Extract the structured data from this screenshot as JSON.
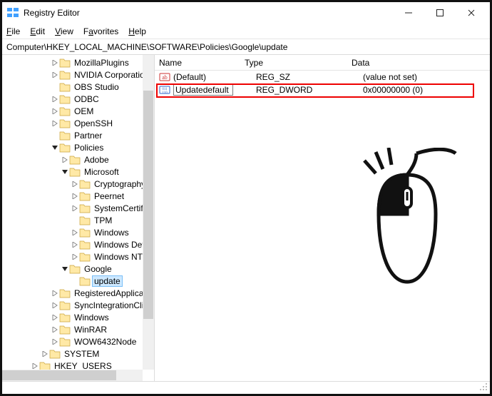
{
  "title": "Registry Editor",
  "win": {
    "min": "—",
    "max": "▢",
    "close": "✕"
  },
  "menus": {
    "file": "File",
    "edit": "Edit",
    "view": "View",
    "favorites": "Favorites",
    "help": "Help"
  },
  "address": "Computer\\HKEY_LOCAL_MACHINE\\SOFTWARE\\Policies\\Google\\update",
  "tree": {
    "items": [
      {
        "indent": 4,
        "chev": ">",
        "label": "MozillaPlugins"
      },
      {
        "indent": 4,
        "chev": ">",
        "label": "NVIDIA Corporation"
      },
      {
        "indent": 4,
        "chev": "",
        "label": "OBS Studio"
      },
      {
        "indent": 4,
        "chev": ">",
        "label": "ODBC"
      },
      {
        "indent": 4,
        "chev": ">",
        "label": "OEM"
      },
      {
        "indent": 4,
        "chev": ">",
        "label": "OpenSSH"
      },
      {
        "indent": 4,
        "chev": "",
        "label": "Partner"
      },
      {
        "indent": 4,
        "chev": "v",
        "label": "Policies"
      },
      {
        "indent": 5,
        "chev": ">",
        "label": "Adobe"
      },
      {
        "indent": 5,
        "chev": "v",
        "label": "Microsoft"
      },
      {
        "indent": 6,
        "chev": ">",
        "label": "Cryptography"
      },
      {
        "indent": 6,
        "chev": ">",
        "label": "Peernet"
      },
      {
        "indent": 6,
        "chev": ">",
        "label": "SystemCertifica"
      },
      {
        "indent": 6,
        "chev": "",
        "label": "TPM"
      },
      {
        "indent": 6,
        "chev": ">",
        "label": "Windows"
      },
      {
        "indent": 6,
        "chev": ">",
        "label": "Windows Defen"
      },
      {
        "indent": 6,
        "chev": ">",
        "label": "Windows NT"
      },
      {
        "indent": 5,
        "chev": "v",
        "label": "Google"
      },
      {
        "indent": 6,
        "chev": "",
        "label": "update",
        "selected": true
      },
      {
        "indent": 4,
        "chev": ">",
        "label": "RegisteredApplication"
      },
      {
        "indent": 4,
        "chev": ">",
        "label": "SyncIntegrationClient"
      },
      {
        "indent": 4,
        "chev": ">",
        "label": "Windows"
      },
      {
        "indent": 4,
        "chev": ">",
        "label": "WinRAR"
      },
      {
        "indent": 4,
        "chev": ">",
        "label": "WOW6432Node"
      },
      {
        "indent": 3,
        "chev": ">",
        "label": "SYSTEM"
      },
      {
        "indent": 2,
        "chev": ">",
        "label": "HKEY_USERS"
      }
    ]
  },
  "list": {
    "headers": {
      "name": "Name",
      "type": "Type",
      "data": "Data"
    },
    "rows": [
      {
        "icon": "str",
        "name": "(Default)",
        "type": "REG_SZ",
        "data": "(value not set)",
        "editing": false
      },
      {
        "icon": "num",
        "name": "Updatedefault",
        "type": "REG_DWORD",
        "data": "0x00000000 (0)",
        "editing": true
      }
    ]
  }
}
